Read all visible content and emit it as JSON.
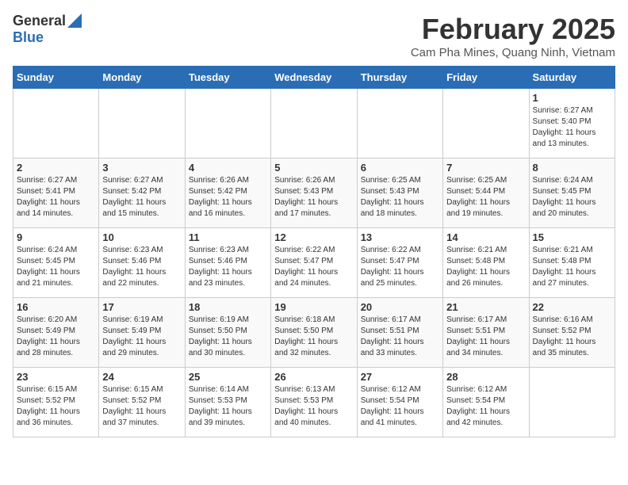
{
  "header": {
    "logo_general": "General",
    "logo_blue": "Blue",
    "title": "February 2025",
    "location": "Cam Pha Mines, Quang Ninh, Vietnam"
  },
  "calendar": {
    "days_of_week": [
      "Sunday",
      "Monday",
      "Tuesday",
      "Wednesday",
      "Thursday",
      "Friday",
      "Saturday"
    ],
    "weeks": [
      [
        {
          "day": "",
          "info": ""
        },
        {
          "day": "",
          "info": ""
        },
        {
          "day": "",
          "info": ""
        },
        {
          "day": "",
          "info": ""
        },
        {
          "day": "",
          "info": ""
        },
        {
          "day": "",
          "info": ""
        },
        {
          "day": "1",
          "info": "Sunrise: 6:27 AM\nSunset: 5:40 PM\nDaylight: 11 hours\nand 13 minutes."
        }
      ],
      [
        {
          "day": "2",
          "info": "Sunrise: 6:27 AM\nSunset: 5:41 PM\nDaylight: 11 hours\nand 14 minutes."
        },
        {
          "day": "3",
          "info": "Sunrise: 6:27 AM\nSunset: 5:42 PM\nDaylight: 11 hours\nand 15 minutes."
        },
        {
          "day": "4",
          "info": "Sunrise: 6:26 AM\nSunset: 5:42 PM\nDaylight: 11 hours\nand 16 minutes."
        },
        {
          "day": "5",
          "info": "Sunrise: 6:26 AM\nSunset: 5:43 PM\nDaylight: 11 hours\nand 17 minutes."
        },
        {
          "day": "6",
          "info": "Sunrise: 6:25 AM\nSunset: 5:43 PM\nDaylight: 11 hours\nand 18 minutes."
        },
        {
          "day": "7",
          "info": "Sunrise: 6:25 AM\nSunset: 5:44 PM\nDaylight: 11 hours\nand 19 minutes."
        },
        {
          "day": "8",
          "info": "Sunrise: 6:24 AM\nSunset: 5:45 PM\nDaylight: 11 hours\nand 20 minutes."
        }
      ],
      [
        {
          "day": "9",
          "info": "Sunrise: 6:24 AM\nSunset: 5:45 PM\nDaylight: 11 hours\nand 21 minutes."
        },
        {
          "day": "10",
          "info": "Sunrise: 6:23 AM\nSunset: 5:46 PM\nDaylight: 11 hours\nand 22 minutes."
        },
        {
          "day": "11",
          "info": "Sunrise: 6:23 AM\nSunset: 5:46 PM\nDaylight: 11 hours\nand 23 minutes."
        },
        {
          "day": "12",
          "info": "Sunrise: 6:22 AM\nSunset: 5:47 PM\nDaylight: 11 hours\nand 24 minutes."
        },
        {
          "day": "13",
          "info": "Sunrise: 6:22 AM\nSunset: 5:47 PM\nDaylight: 11 hours\nand 25 minutes."
        },
        {
          "day": "14",
          "info": "Sunrise: 6:21 AM\nSunset: 5:48 PM\nDaylight: 11 hours\nand 26 minutes."
        },
        {
          "day": "15",
          "info": "Sunrise: 6:21 AM\nSunset: 5:48 PM\nDaylight: 11 hours\nand 27 minutes."
        }
      ],
      [
        {
          "day": "16",
          "info": "Sunrise: 6:20 AM\nSunset: 5:49 PM\nDaylight: 11 hours\nand 28 minutes."
        },
        {
          "day": "17",
          "info": "Sunrise: 6:19 AM\nSunset: 5:49 PM\nDaylight: 11 hours\nand 29 minutes."
        },
        {
          "day": "18",
          "info": "Sunrise: 6:19 AM\nSunset: 5:50 PM\nDaylight: 11 hours\nand 30 minutes."
        },
        {
          "day": "19",
          "info": "Sunrise: 6:18 AM\nSunset: 5:50 PM\nDaylight: 11 hours\nand 32 minutes."
        },
        {
          "day": "20",
          "info": "Sunrise: 6:17 AM\nSunset: 5:51 PM\nDaylight: 11 hours\nand 33 minutes."
        },
        {
          "day": "21",
          "info": "Sunrise: 6:17 AM\nSunset: 5:51 PM\nDaylight: 11 hours\nand 34 minutes."
        },
        {
          "day": "22",
          "info": "Sunrise: 6:16 AM\nSunset: 5:52 PM\nDaylight: 11 hours\nand 35 minutes."
        }
      ],
      [
        {
          "day": "23",
          "info": "Sunrise: 6:15 AM\nSunset: 5:52 PM\nDaylight: 11 hours\nand 36 minutes."
        },
        {
          "day": "24",
          "info": "Sunrise: 6:15 AM\nSunset: 5:52 PM\nDaylight: 11 hours\nand 37 minutes."
        },
        {
          "day": "25",
          "info": "Sunrise: 6:14 AM\nSunset: 5:53 PM\nDaylight: 11 hours\nand 39 minutes."
        },
        {
          "day": "26",
          "info": "Sunrise: 6:13 AM\nSunset: 5:53 PM\nDaylight: 11 hours\nand 40 minutes."
        },
        {
          "day": "27",
          "info": "Sunrise: 6:12 AM\nSunset: 5:54 PM\nDaylight: 11 hours\nand 41 minutes."
        },
        {
          "day": "28",
          "info": "Sunrise: 6:12 AM\nSunset: 5:54 PM\nDaylight: 11 hours\nand 42 minutes."
        },
        {
          "day": "",
          "info": ""
        }
      ]
    ]
  }
}
